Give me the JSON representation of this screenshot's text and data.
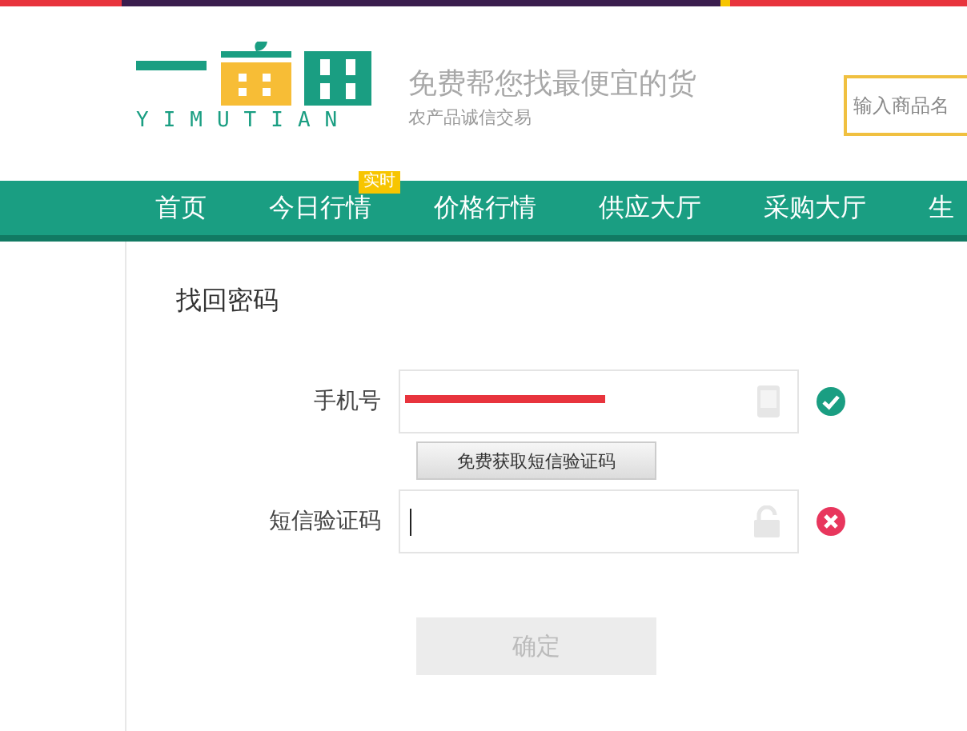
{
  "header": {
    "brand": "YIMUTIAN",
    "slogan": "免费帮您找最便宜的货",
    "subslogan": "农产品诚信交易",
    "search": {
      "placeholder": "输入商品名"
    }
  },
  "nav": {
    "items": [
      {
        "label": "首页"
      },
      {
        "label": "今日行情",
        "badge": "实时"
      },
      {
        "label": "价格行情"
      },
      {
        "label": "供应大厅"
      },
      {
        "label": "采购大厅"
      },
      {
        "label": "生"
      }
    ]
  },
  "form": {
    "title": "找回密码",
    "fields": [
      {
        "label": "手机号",
        "kind": "phone",
        "valid": true,
        "redacted": true
      },
      {
        "label": "短信验证码",
        "kind": "code",
        "valid": false,
        "focused": true
      }
    ],
    "sms_button": "免费获取短信验证码",
    "submit": {
      "label": "确定",
      "disabled": true
    }
  }
}
